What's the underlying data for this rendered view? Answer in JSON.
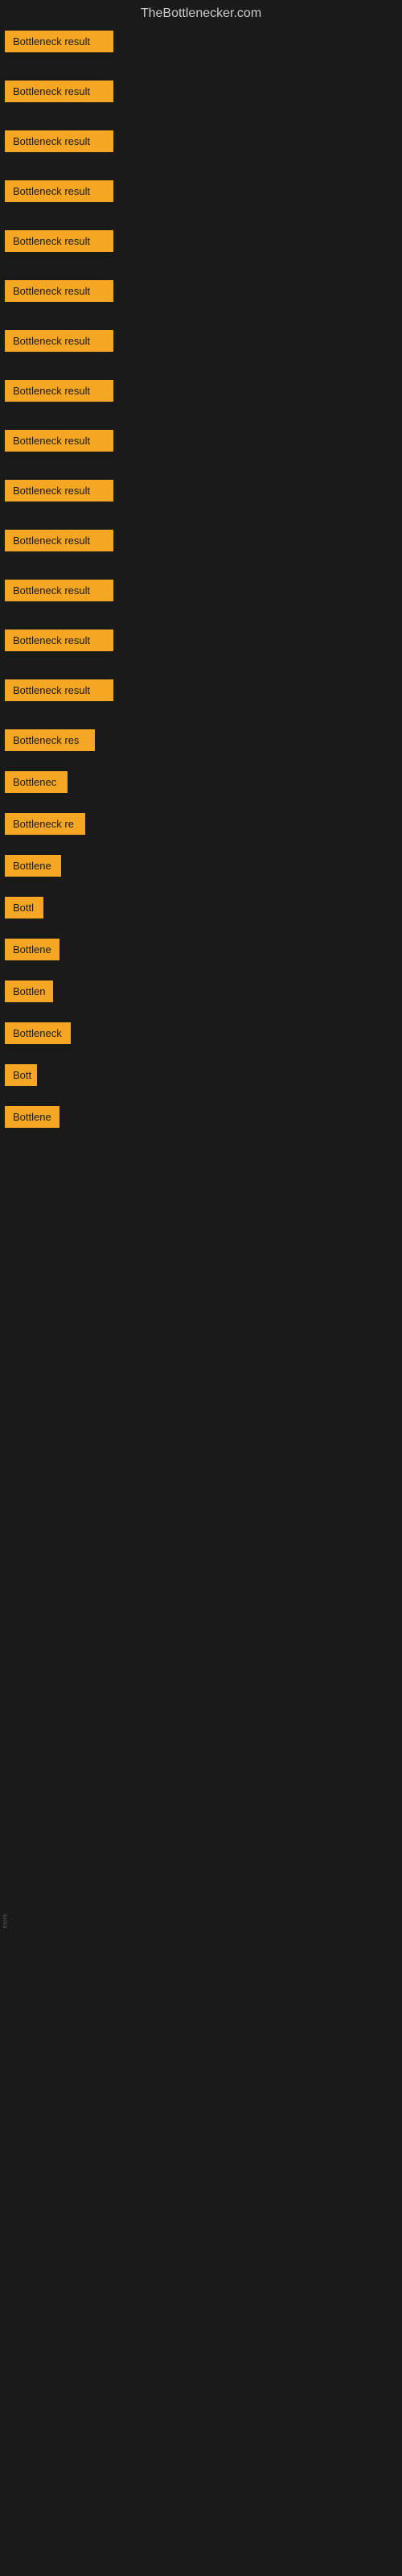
{
  "site": {
    "title": "TheBottlenecker.com"
  },
  "items": [
    {
      "id": 1,
      "label": "Bottleneck result",
      "width": 135
    },
    {
      "id": 2,
      "label": "Bottleneck result",
      "width": 135
    },
    {
      "id": 3,
      "label": "Bottleneck result",
      "width": 135
    },
    {
      "id": 4,
      "label": "Bottleneck result",
      "width": 135
    },
    {
      "id": 5,
      "label": "Bottleneck result",
      "width": 135
    },
    {
      "id": 6,
      "label": "Bottleneck result",
      "width": 135
    },
    {
      "id": 7,
      "label": "Bottleneck result",
      "width": 135
    },
    {
      "id": 8,
      "label": "Bottleneck result",
      "width": 135
    },
    {
      "id": 9,
      "label": "Bottleneck result",
      "width": 135
    },
    {
      "id": 10,
      "label": "Bottleneck result",
      "width": 135
    },
    {
      "id": 11,
      "label": "Bottleneck result",
      "width": 135
    },
    {
      "id": 12,
      "label": "Bottleneck result",
      "width": 135
    },
    {
      "id": 13,
      "label": "Bottleneck result",
      "width": 135
    },
    {
      "id": 14,
      "label": "Bottleneck result",
      "width": 135
    },
    {
      "id": 15,
      "label": "Bottleneck res",
      "width": 112
    },
    {
      "id": 16,
      "label": "Bottlenec",
      "width": 78
    },
    {
      "id": 17,
      "label": "Bottleneck re",
      "width": 100
    },
    {
      "id": 18,
      "label": "Bottlene",
      "width": 70
    },
    {
      "id": 19,
      "label": "Bottl",
      "width": 48
    },
    {
      "id": 20,
      "label": "Bottlene",
      "width": 68
    },
    {
      "id": 21,
      "label": "Bottlen",
      "width": 60
    },
    {
      "id": 22,
      "label": "Bottleneck",
      "width": 82
    },
    {
      "id": 23,
      "label": "Bott",
      "width": 40
    },
    {
      "id": 24,
      "label": "Bottlene",
      "width": 68
    }
  ],
  "footer": {
    "label": "more"
  }
}
